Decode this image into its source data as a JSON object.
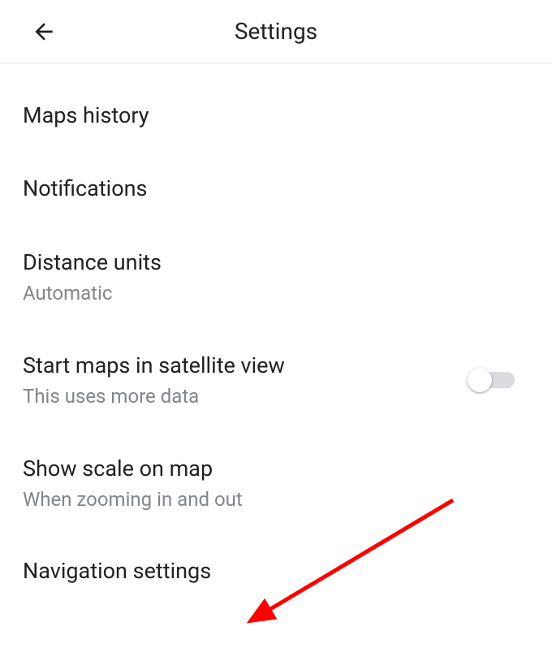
{
  "header": {
    "title": "Settings"
  },
  "rows": {
    "maps_history": {
      "title": "Maps history"
    },
    "notifications": {
      "title": "Notifications"
    },
    "distance_units": {
      "title": "Distance units",
      "sub": "Automatic"
    },
    "satellite": {
      "title": "Start maps in satellite view",
      "sub": "This uses more data"
    },
    "scale": {
      "title": "Show scale on map",
      "sub": "When zooming in and out"
    },
    "navigation": {
      "title": "Navigation settings"
    }
  }
}
